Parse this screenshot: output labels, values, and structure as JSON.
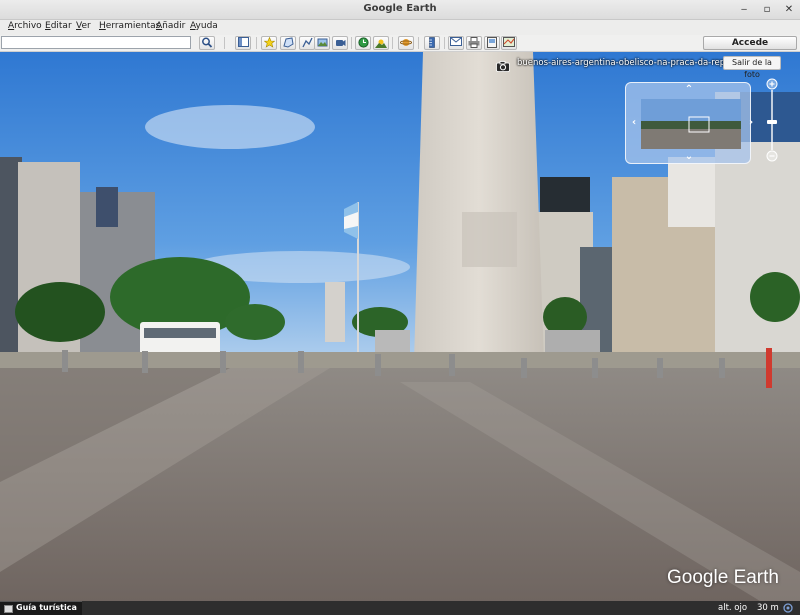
{
  "window": {
    "title": "Google Earth"
  },
  "menu": [
    "Archivo",
    "Editar",
    "Ver",
    "Herramientas",
    "Añadir",
    "Ayuda"
  ],
  "search": {
    "value": "",
    "placeholder": ""
  },
  "toolbar": {
    "login_label": "Accede"
  },
  "photo": {
    "title": "buenos-aires-argentina-obelisco-na-praca-da-republica",
    "exit_label": "Salir de la foto"
  },
  "logo": {
    "word1": "Google",
    "word2": "Earth"
  },
  "status": {
    "tour_label": "Guía turística",
    "alt_label": "alt. ojo",
    "alt_value": "30 m"
  },
  "icons": {
    "search": "magnifier-icon",
    "sidebar": "sidebar-toggle-icon",
    "placemark": "placemark-icon",
    "polygon": "polygon-icon",
    "path": "path-icon",
    "overlay": "image-overlay-icon",
    "tour": "record-tour-icon",
    "historical": "historical-imagery-icon",
    "sunlight": "sunlight-icon",
    "planets": "planets-icon",
    "ruler": "ruler-icon",
    "email": "email-icon",
    "print": "print-icon",
    "save": "save-image-icon",
    "maps": "google-maps-icon",
    "camera": "camera-icon"
  }
}
